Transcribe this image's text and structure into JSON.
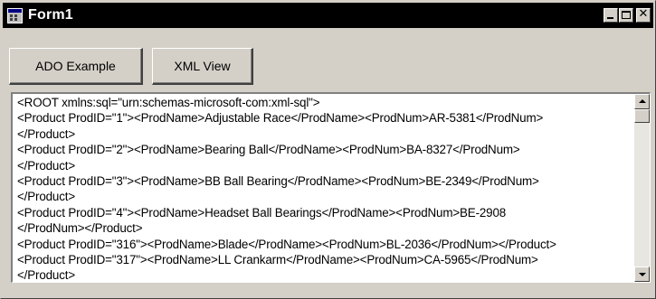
{
  "window": {
    "title": "Form1",
    "icon": "form-icon",
    "controls": {
      "minimize_icon": "minimize-icon",
      "maximize_icon": "maximize-icon",
      "close_icon": "close-icon"
    }
  },
  "buttons": {
    "ado_label": "ADO Example",
    "xml_label": "XML View"
  },
  "textbox": {
    "lines": [
      "<ROOT xmlns:sql=\"urn:schemas-microsoft-com:xml-sql\">",
      "<Product ProdID=\"1\"><ProdName>Adjustable Race</ProdName><ProdNum>AR-5381</ProdNum>",
      "</Product>",
      "<Product ProdID=\"2\"><ProdName>Bearing Ball</ProdName><ProdNum>BA-8327</ProdNum>",
      "</Product>",
      "<Product ProdID=\"3\"><ProdName>BB Ball Bearing</ProdName><ProdNum>BE-2349</ProdNum>",
      "</Product>",
      "<Product ProdID=\"4\"><ProdName>Headset Ball Bearings</ProdName><ProdNum>BE-2908",
      "</ProdNum></Product>",
      "<Product ProdID=\"316\"><ProdName>Blade</ProdName><ProdNum>BL-2036</ProdNum></Product>",
      "<Product ProdID=\"317\"><ProdName>LL Crankarm</ProdName><ProdNum>CA-5965</ProdNum>",
      "</Product>"
    ]
  },
  "scrollbar": {
    "up_icon": "scroll-up-arrow-icon",
    "down_icon": "scroll-down-arrow-icon"
  },
  "colors": {
    "window_face": "#d4d0c8",
    "titlebar": "#000000",
    "title_text": "#ffffff",
    "textbox_background": "#ffffff"
  }
}
